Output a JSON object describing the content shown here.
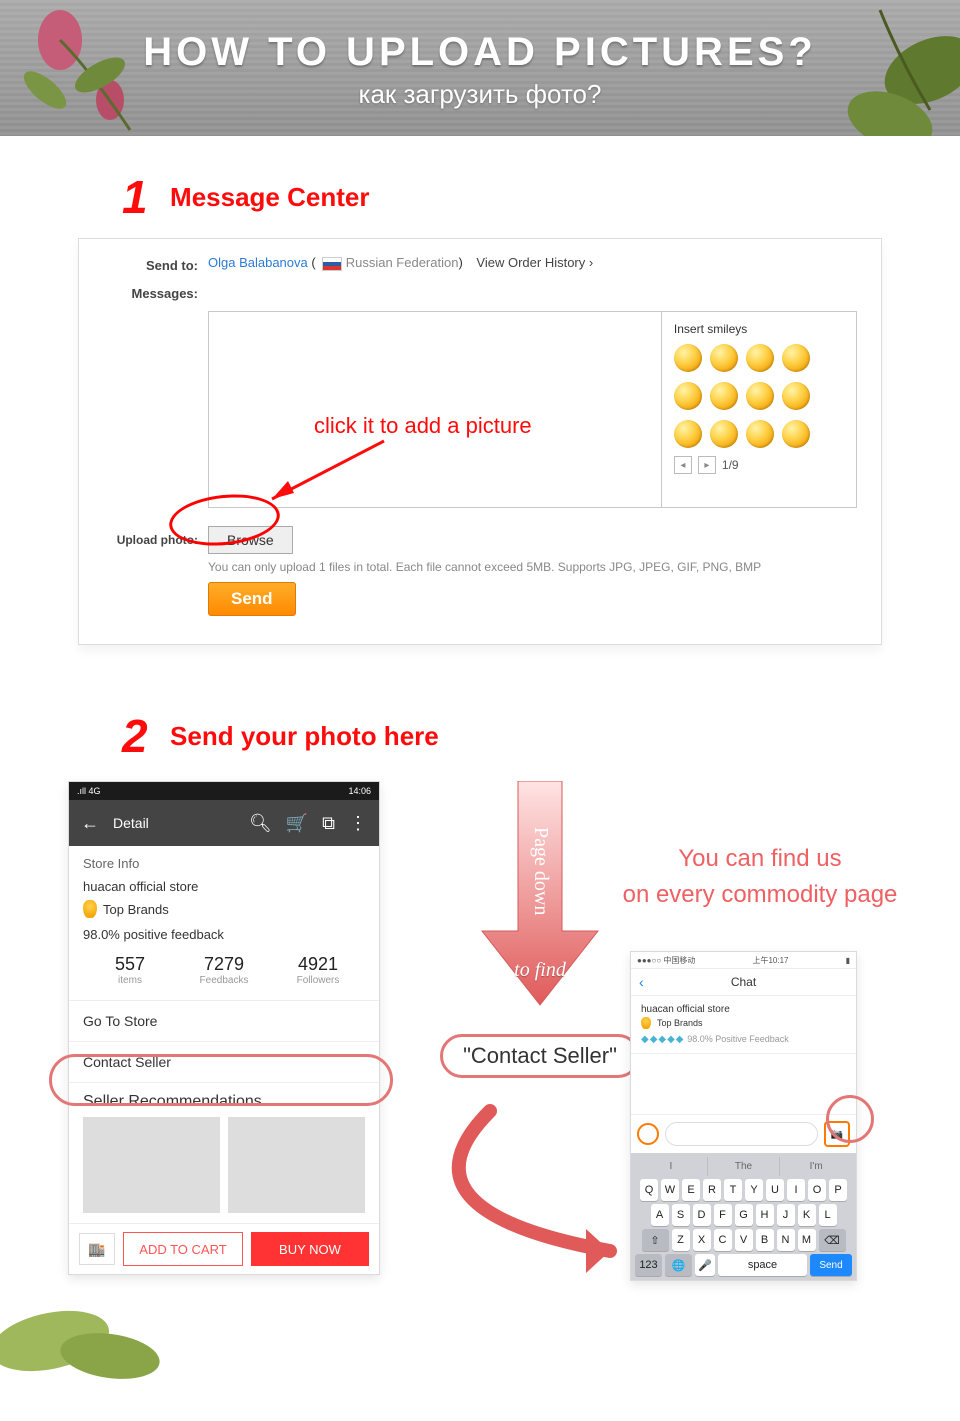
{
  "banner": {
    "title": "HOW TO UPLOAD PICTURES?",
    "subtitle": "как загрузить фото?"
  },
  "step1": {
    "num": "1",
    "label": "Message Center",
    "sendto_label": "Send to:",
    "recipient": "Olga Balabanova",
    "country": "Russian Federation",
    "order_history": "View Order History",
    "messages_label": "Messages:",
    "smileys_title": "Insert smileys",
    "pager": "1/9",
    "annotation": "click it to add a picture",
    "upload_label": "Upload photo:",
    "browse": "Browse",
    "note": "You can only upload 1 files in total. Each file cannot exceed 5MB. Supports JPG, JPEG, GIF, PNG, BMP",
    "send": "Send"
  },
  "step2": {
    "num": "2",
    "label": "Send your photo here",
    "phone1": {
      "signal": ".ıll 4G",
      "time": "14:06",
      "detail": "Detail",
      "store_info": "Store Info",
      "store_name": "huacan official store",
      "top_brands": "Top Brands",
      "feedback": "98.0% positive feedback",
      "m1n": "557",
      "m1t": "items",
      "m2n": "7279",
      "m2t": "Feedbacks",
      "m3n": "4921",
      "m3t": "Followers",
      "goto": "Go To Store",
      "contact": "Contact Seller",
      "recs": "Seller Recommendations",
      "addcart": "ADD TO CART",
      "buynow": "BUY NOW"
    },
    "arrow_text_top": "Page down",
    "arrow_text_bottom": "to find",
    "pill": "\"Contact Seller\"",
    "right_l1": "You can find us",
    "right_l2": "on every commodity page",
    "phone2": {
      "carrier": "●●●○○ 中国移动",
      "time": "上午10:17",
      "chat": "Chat",
      "store_name": "huacan official store",
      "top_brands": "Top Brands",
      "feedback": "98.0% Positive Feedback",
      "sugg1": "I",
      "sugg2": "The",
      "sugg3": "I'm",
      "row1": [
        "Q",
        "W",
        "E",
        "R",
        "T",
        "Y",
        "U",
        "I",
        "O",
        "P"
      ],
      "row2": [
        "A",
        "S",
        "D",
        "F",
        "G",
        "H",
        "J",
        "K",
        "L"
      ],
      "row3": [
        "Z",
        "X",
        "C",
        "V",
        "B",
        "N",
        "M"
      ],
      "k123": "123",
      "space": "space",
      "send": "Send"
    }
  }
}
